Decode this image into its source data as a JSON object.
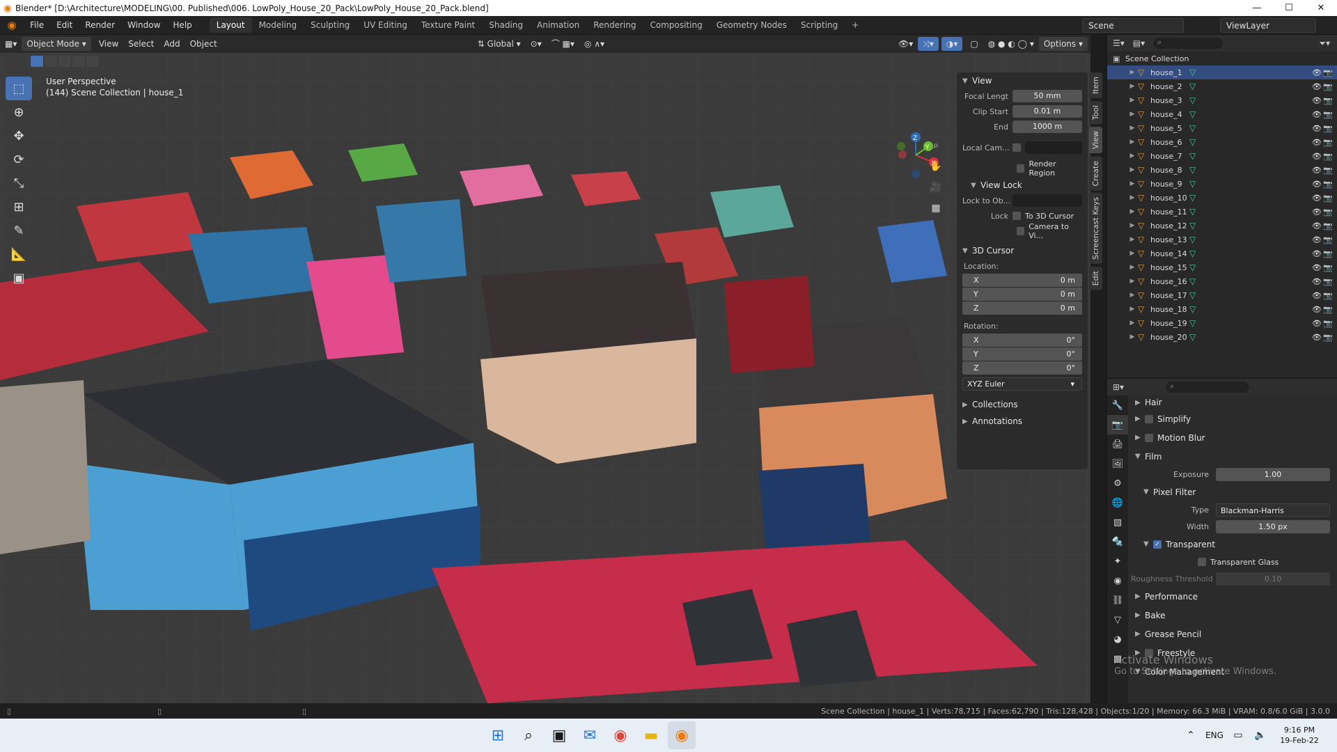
{
  "window": {
    "title": "Blender* [D:\\Architecture\\MODELING\\00. Published\\006. LowPoly_House_20_Pack\\LowPoly_House_20_Pack.blend]",
    "minimize": "—",
    "maximize": "☐",
    "close": "✕"
  },
  "menus": [
    "File",
    "Edit",
    "Render",
    "Window",
    "Help"
  ],
  "workspaces": [
    "Layout",
    "Modeling",
    "Sculpting",
    "UV Editing",
    "Texture Paint",
    "Shading",
    "Animation",
    "Rendering",
    "Compositing",
    "Geometry Nodes",
    "Scripting"
  ],
  "workspace_add": "+",
  "scene": {
    "name": "Scene",
    "view_layer": "ViewLayer"
  },
  "viewport_header": {
    "mode": "Object Mode",
    "menu": [
      "View",
      "Select",
      "Add",
      "Object"
    ],
    "orientation": "Global",
    "options": "Options"
  },
  "viewport": {
    "perspective": "User Perspective",
    "collection_info": "(144) Scene Collection | house_1",
    "gizmo_labels": {
      "z": "Z",
      "y": "Y",
      "x": "X"
    }
  },
  "npanel": {
    "view_header": "View",
    "focal_label": "Focal Lengt",
    "focal_value": "50 mm",
    "clip_start_label": "Clip Start",
    "clip_start_value": "0.01 m",
    "clip_end_label": "End",
    "clip_end_value": "1000 m",
    "local_cam_label": "Local Cam...",
    "render_region": "Render Region",
    "view_lock_header": "View Lock",
    "lock_to_obj_label": "Lock to Ob...",
    "lock_label": "Lock",
    "to_3d_cursor": "To 3D Cursor",
    "camera_to_view": "Camera to Vi...",
    "cursor_header": "3D Cursor",
    "location_label": "Location:",
    "loc": [
      {
        "axis": "X",
        "value": "0 m"
      },
      {
        "axis": "Y",
        "value": "0 m"
      },
      {
        "axis": "Z",
        "value": "0 m"
      }
    ],
    "rotation_label": "Rotation:",
    "rot": [
      {
        "axis": "X",
        "value": "0°"
      },
      {
        "axis": "Y",
        "value": "0°"
      },
      {
        "axis": "Z",
        "value": "0°"
      }
    ],
    "rot_mode": "XYZ Euler",
    "collections_header": "Collections",
    "annotations_header": "Annotations",
    "tabs": [
      "Item",
      "Tool",
      "View",
      "Create",
      "Screencast Keys",
      "Edit"
    ]
  },
  "outliner": {
    "root": "Scene Collection",
    "items": [
      "house_1",
      "house_2",
      "house_3",
      "house_4",
      "house_5",
      "house_6",
      "house_7",
      "house_8",
      "house_9",
      "house_10",
      "house_11",
      "house_12",
      "house_13",
      "house_14",
      "house_15",
      "house_16",
      "house_17",
      "house_18",
      "house_19",
      "house_20"
    ]
  },
  "properties": {
    "hair": "Hair",
    "simplify": "Simplify",
    "motion_blur": "Motion Blur",
    "film": "Film",
    "exposure_label": "Exposure",
    "exposure_value": "1.00",
    "pixel_filter": "Pixel Filter",
    "type_label": "Type",
    "type_value": "Blackman-Harris",
    "width_label": "Width",
    "width_value": "1.50 px",
    "transparent": "Transparent",
    "transparent_glass": "Transparent Glass",
    "roughness_label": "Roughness Threshold",
    "roughness_value": "0.10",
    "performance": "Performance",
    "bake": "Bake",
    "grease_pencil": "Grease Pencil",
    "freestyle": "Freestyle",
    "color_management": "Color Management"
  },
  "statusbar": "Scene Collection | house_1 | Verts:78,715 | Faces:62,790 | Tris:128,428 | Objects:1/20 | Memory: 66.3 MiB | VRAM: 0.8/6.0 GiB | 3.0.0",
  "watermark": {
    "line1": "Activate Windows",
    "line2": "Go to Settings to activate Windows."
  },
  "taskbar": {
    "lang": "ENG",
    "time": "9:16 PM",
    "date": "19-Feb-22"
  },
  "colors": {
    "accent": "#4772b3",
    "blender_orange": "#e87d0d",
    "mesh_green": "#4fc8a0",
    "selection": "#334d80"
  }
}
